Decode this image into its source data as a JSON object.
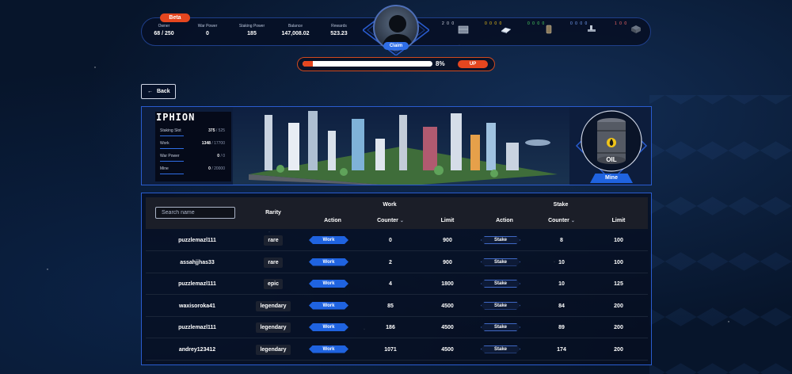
{
  "header": {
    "beta_badge": "Beta",
    "stats": [
      {
        "label": "Owner",
        "value": "68 / 250"
      },
      {
        "label": "War Power",
        "value": "0"
      },
      {
        "label": "Staking Power",
        "value": "185"
      },
      {
        "label": "Balance",
        "value": "147,008.02"
      },
      {
        "label": "Rewards",
        "value": "523.23"
      }
    ],
    "claim_label": "Claim",
    "resources": [
      {
        "counts": "2 0 0",
        "icon": "crate-icon"
      },
      {
        "counts": "0 0 0 0",
        "icon": "bars-icon"
      },
      {
        "counts": "0 0 0 0",
        "icon": "tank-icon"
      },
      {
        "counts": "0 0 0 0",
        "icon": "pipe-icon"
      },
      {
        "counts": "1 0 0",
        "icon": "cube-icon"
      }
    ]
  },
  "progress": {
    "percent_value": 8,
    "percent_text": "8%",
    "up_label": "UP"
  },
  "nav": {
    "back_label": "Back"
  },
  "location": {
    "name": "IPHION",
    "rows": [
      {
        "label": "Staking Slot",
        "value": "375",
        "max": "/ 525"
      },
      {
        "label": "Work",
        "value": "1348",
        "max": "/ 17700"
      },
      {
        "label": "War Power",
        "value": "0",
        "max": "/ 0"
      },
      {
        "label": "Mine",
        "value": "0",
        "max": "/ 20000"
      }
    ],
    "resource_label": "OIL",
    "mine_label": "Mine"
  },
  "table": {
    "search_placeholder": "Search name",
    "headers": {
      "rarity": "Rarity",
      "work_group": "Work",
      "stake_group": "Stake",
      "action": "Action",
      "counter": "Counter",
      "limit": "Limit",
      "stake_action": "Action",
      "stake_counter": "Counter",
      "stake_limit": "Limit"
    },
    "work_button": "Work",
    "stake_button": "Stake",
    "rows": [
      {
        "name": "puzzlemazl111",
        "rarity": "rare",
        "work_counter": "0",
        "work_limit": "900",
        "stake_counter": "8",
        "stake_limit": "100"
      },
      {
        "name": "assahjjhas33",
        "rarity": "rare",
        "work_counter": "2",
        "work_limit": "900",
        "stake_counter": "10",
        "stake_limit": "100"
      },
      {
        "name": "puzzlemazl111",
        "rarity": "epic",
        "work_counter": "4",
        "work_limit": "1800",
        "stake_counter": "10",
        "stake_limit": "125"
      },
      {
        "name": "waxisoroka41",
        "rarity": "legendary",
        "work_counter": "85",
        "work_limit": "4500",
        "stake_counter": "84",
        "stake_limit": "200"
      },
      {
        "name": "puzzlemazl111",
        "rarity": "legendary",
        "work_counter": "186",
        "work_limit": "4500",
        "stake_counter": "89",
        "stake_limit": "200"
      },
      {
        "name": "andrey123412",
        "rarity": "legendary",
        "work_counter": "1071",
        "work_limit": "4500",
        "stake_counter": "174",
        "stake_limit": "200"
      }
    ]
  }
}
